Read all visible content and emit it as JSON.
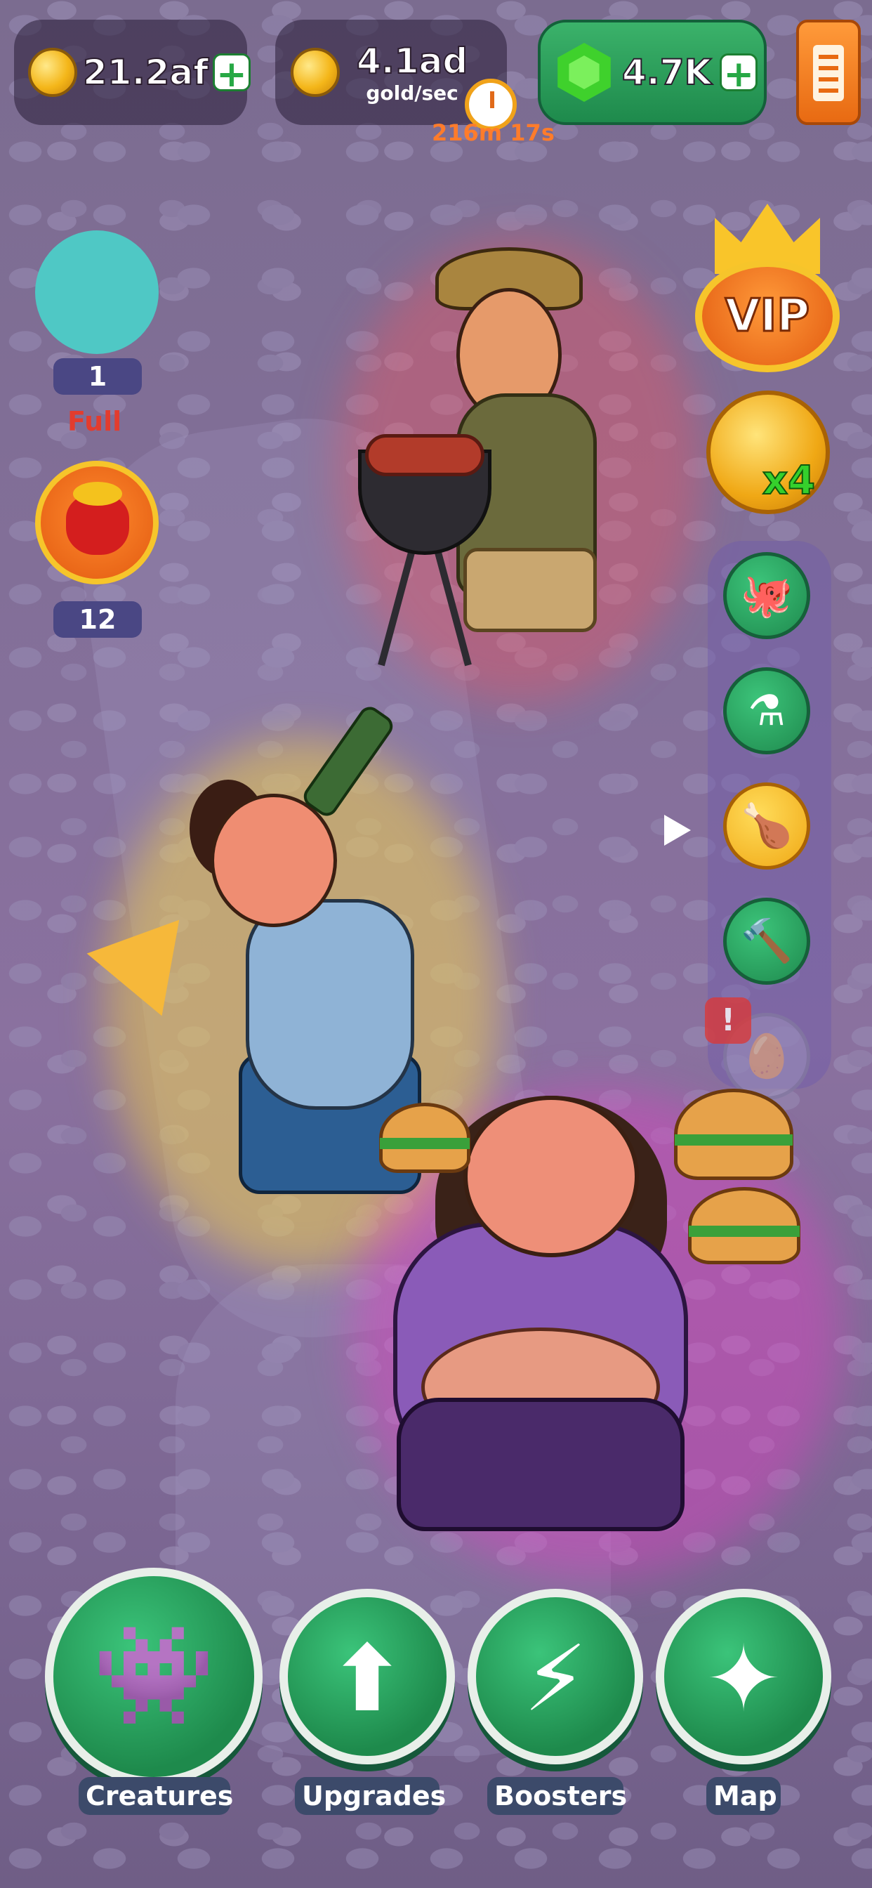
{
  "hud": {
    "gold_total": "21.2af",
    "gold_rate": "4.1ad",
    "gold_rate_unit": "gold/sec",
    "timer": "216m 17s",
    "gems": "4.7K",
    "plus_icon": "+"
  },
  "left_panel": {
    "slot_count": "1",
    "slot_status": "Full",
    "bag_count": "12"
  },
  "right_panel": {
    "vip_label": "VIP",
    "multiplier_label": "x4",
    "side_buttons": [
      {
        "icon": "tentacle-icon",
        "glyph": "🐙"
      },
      {
        "icon": "flask-icon",
        "glyph": "⚗"
      },
      {
        "icon": "drumstick-icon",
        "glyph": "🍗"
      },
      {
        "icon": "hammer-icon",
        "glyph": "🔨"
      },
      {
        "icon": "egg-icon",
        "glyph": "🥚"
      }
    ],
    "alert_label": "!"
  },
  "bottom_nav": [
    {
      "label": "Creatures",
      "icon": "creature-icon",
      "glyph": "👾"
    },
    {
      "label": "Upgrades",
      "icon": "arrow-up-icon",
      "glyph": "⬆"
    },
    {
      "label": "Boosters",
      "icon": "lightning-icon",
      "glyph": "⚡"
    },
    {
      "label": "Map",
      "icon": "constellation-icon",
      "glyph": "✦"
    }
  ],
  "colors": {
    "accent_green": "#1e8a4c",
    "gold": "#f4b619",
    "timer_orange": "#ff7c2b",
    "full_red": "#e33c2e",
    "vip_orange": "#e25a10"
  }
}
